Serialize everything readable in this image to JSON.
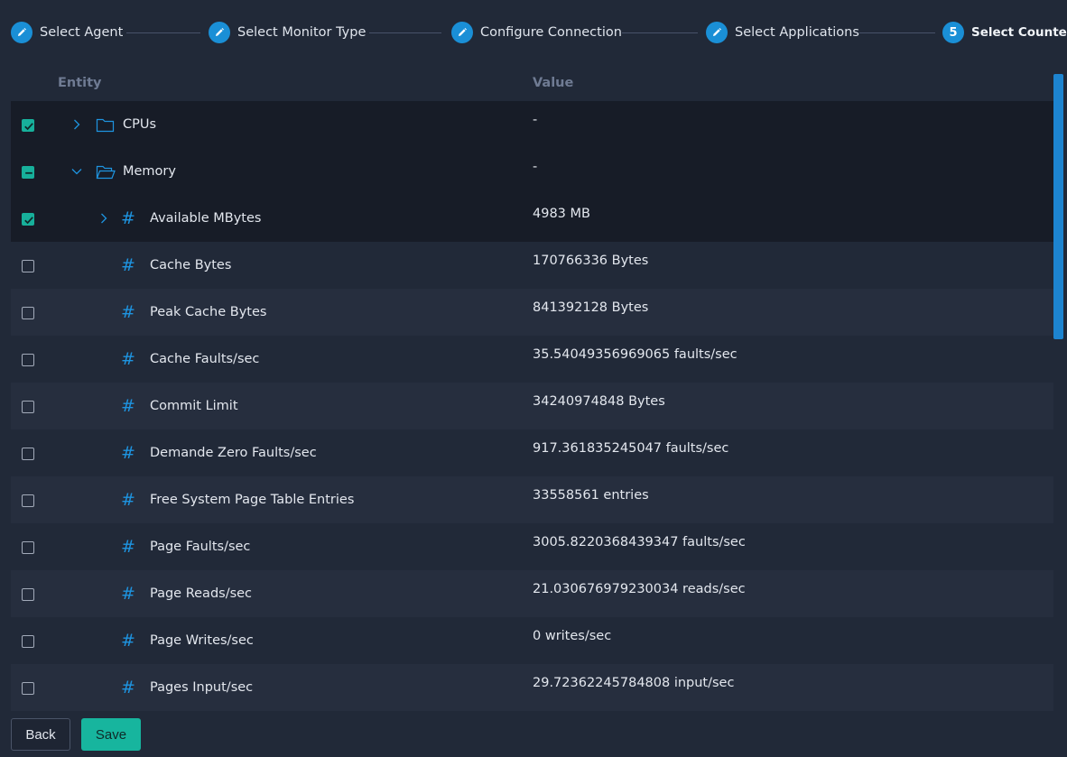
{
  "wizard": {
    "steps": [
      {
        "label": "Select Agent",
        "marker": "pencil-icon"
      },
      {
        "label": "Select Monitor Type",
        "marker": "pencil-icon"
      },
      {
        "label": "Configure Connection",
        "marker": "pencil-icon"
      },
      {
        "label": "Select Applications",
        "marker": "pencil-icon"
      },
      {
        "label": "Select Counters",
        "number": "5"
      }
    ]
  },
  "table": {
    "headers": {
      "entity": "Entity",
      "value": "Value"
    },
    "rows": [
      {
        "checkbox": "checked",
        "expander": "collapsed",
        "icon": "folder-icon",
        "entity": "CPUs",
        "value": "-"
      },
      {
        "checkbox": "indeterminate",
        "expander": "expanded",
        "icon": "folder-open-icon",
        "entity": "Memory",
        "value": "-"
      },
      {
        "checkbox": "checked",
        "expander": "collapsed",
        "icon": "hash-icon",
        "entity": "Available MBytes",
        "value": "4983 MB"
      },
      {
        "checkbox": "unchecked",
        "icon": "hash-icon",
        "entity": "Cache Bytes",
        "value": "170766336 Bytes"
      },
      {
        "checkbox": "unchecked",
        "icon": "hash-icon",
        "entity": "Peak Cache Bytes",
        "value": "841392128 Bytes"
      },
      {
        "checkbox": "unchecked",
        "icon": "hash-icon",
        "entity": "Cache Faults/sec",
        "value": "35.54049356969065 faults/sec"
      },
      {
        "checkbox": "unchecked",
        "icon": "hash-icon",
        "entity": "Commit Limit",
        "value": "34240974848 Bytes"
      },
      {
        "checkbox": "unchecked",
        "icon": "hash-icon",
        "entity": "Demande Zero Faults/sec",
        "value": "917.361835245047 faults/sec"
      },
      {
        "checkbox": "unchecked",
        "icon": "hash-icon",
        "entity": "Free System Page Table Entries",
        "value": "33558561 entries"
      },
      {
        "checkbox": "unchecked",
        "icon": "hash-icon",
        "entity": "Page Faults/sec",
        "value": "3005.8220368439347 faults/sec"
      },
      {
        "checkbox": "unchecked",
        "icon": "hash-icon",
        "entity": "Page Reads/sec",
        "value": "21.030676979230034 reads/sec"
      },
      {
        "checkbox": "unchecked",
        "icon": "hash-icon",
        "entity": "Page Writes/sec",
        "value": "0 writes/sec"
      },
      {
        "checkbox": "unchecked",
        "icon": "hash-icon",
        "entity": "Pages Input/sec",
        "value": "29.72362245784808 input/sec"
      }
    ]
  },
  "footer": {
    "back_label": "Back",
    "save_label": "Save"
  },
  "colors": {
    "accent": "#1a8fd6",
    "save": "#17b59e",
    "background": "#212938"
  }
}
